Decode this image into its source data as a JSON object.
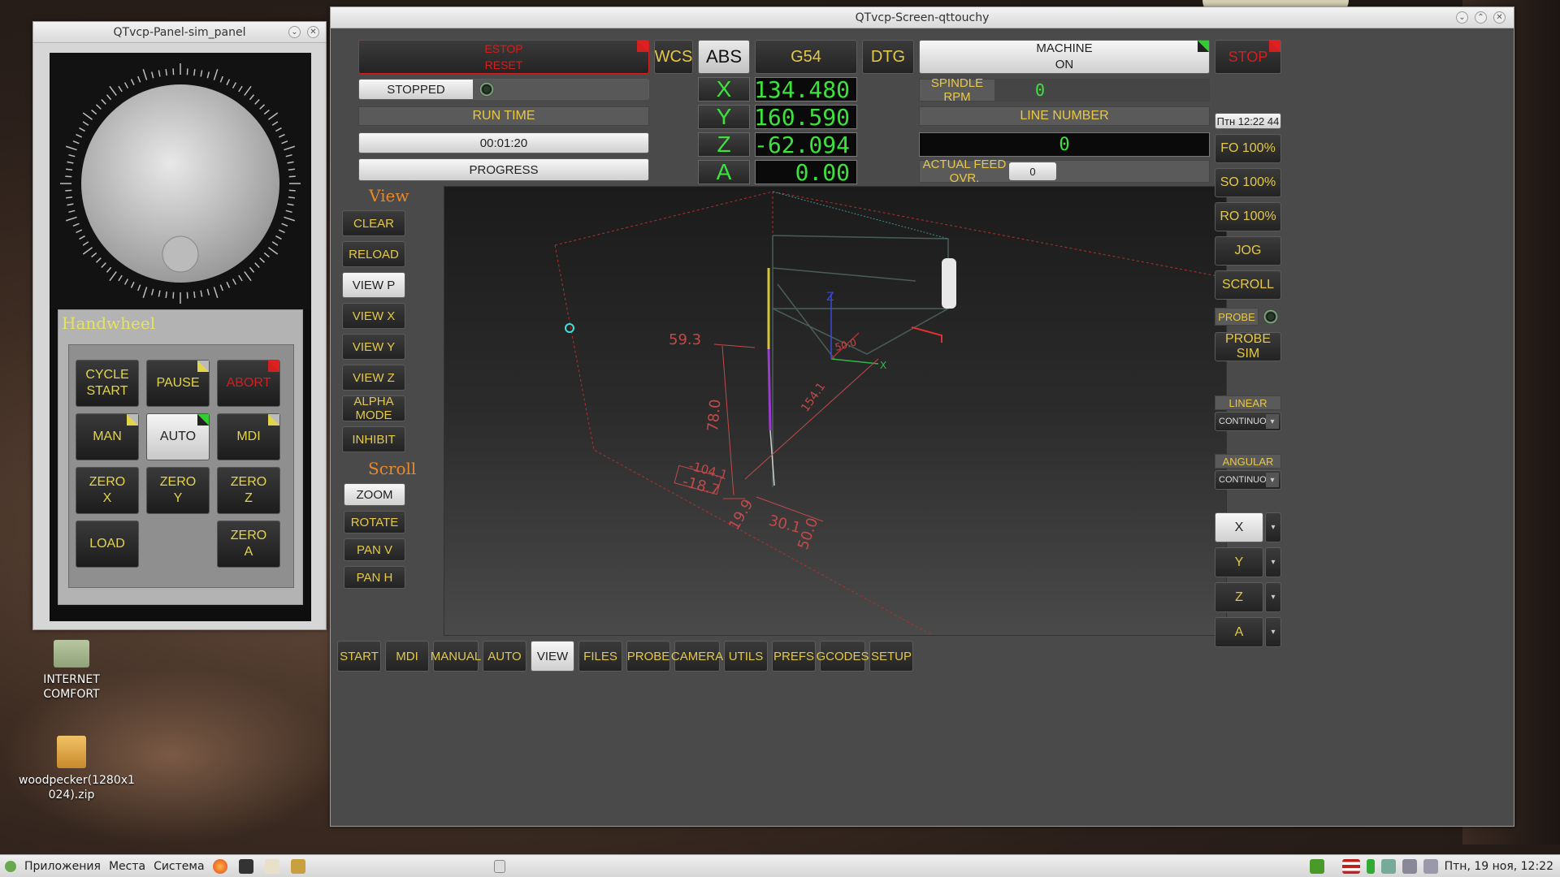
{
  "desktop": {
    "icons": [
      {
        "label": "INTERNET\nCOMFORT"
      },
      {
        "label": "woodpecker(1280x1\n024).zip"
      }
    ]
  },
  "panel_window": {
    "title": "QTvcp-Panel-sim_panel",
    "handwheel_title": "Handwheel",
    "buttons": {
      "cycle_start": "CYCLE\nSTART",
      "pause": "PAUSE",
      "abort": "ABORT",
      "man": "MAN",
      "auto": "AUTO",
      "mdi": "MDI",
      "zero_x": "ZERO\nX",
      "zero_y": "ZERO\nY",
      "zero_z": "ZERO\nZ",
      "load": "LOAD",
      "zero_a": "ZERO\nA"
    }
  },
  "screen_window": {
    "title": "QTvcp-Screen-qttouchy",
    "estop": "ESTOP\nRESET",
    "status": "STOPPED",
    "run_time_label": "RUN TIME",
    "run_time_value": "00:01:20",
    "progress_label": "PROGRESS",
    "wcs": "WCS",
    "abs": "ABS",
    "g54": "G54",
    "dtg": "DTG",
    "machine": "MACHINE\nON",
    "spindle_label": "SPINDLE RPM",
    "spindle_value": "0",
    "line_number_label": "LINE NUMBER",
    "line_number_value": "0",
    "feed_ovr_label": "ACTUAL FEED OVR.",
    "feed_ovr_value": "0",
    "axes": [
      {
        "name": "X",
        "value": "134.480"
      },
      {
        "name": "Y",
        "value": "160.590"
      },
      {
        "name": "Z",
        "value": "-62.094"
      },
      {
        "name": "A",
        "value": "0.00"
      }
    ],
    "view_title": "View",
    "view_buttons": [
      "CLEAR",
      "RELOAD",
      "VIEW P",
      "VIEW X",
      "VIEW Y",
      "VIEW Z",
      "ALPHA MODE",
      "INHIBIT"
    ],
    "scroll_title": "Scroll",
    "scroll_buttons": [
      "ZOOM",
      "ROTATE",
      "PAN V",
      "PAN H"
    ],
    "tabs": [
      "START",
      "MDI",
      "MANUAL",
      "AUTO",
      "VIEW",
      "FILES",
      "PROBE",
      "CAMERA",
      "UTILS",
      "PREFS",
      "GCODES",
      "SETUP"
    ],
    "active_tab": "VIEW",
    "right": {
      "stop": "STOP",
      "clock": "Птн 12:22 44",
      "fo": "FO 100%",
      "so": "SO 100%",
      "ro": "RO 100%",
      "jog": "JOG",
      "scroll": "SCROLL",
      "probe": "PROBE",
      "probe_sim": "PROBE SIM",
      "linear_label": "LINEAR",
      "linear_value": "CONTINUOUS",
      "angular_label": "ANGULAR",
      "angular_value": "CONTINUOUS",
      "jog_axes": [
        "X",
        "Y",
        "Z",
        "A"
      ]
    },
    "dims": [
      "59.3",
      "78.0",
      "-104.1",
      "-18.7",
      "19.9",
      "30.1",
      "50.0",
      "154.1",
      "50.0",
      "Z",
      "X"
    ]
  },
  "taskbar": {
    "apps": "Приложения",
    "places": "Места",
    "system": "Система",
    "clock": "Птн, 19 ноя, 12:22"
  },
  "colors": {
    "accent_yellow": "#e3c84a",
    "lcd_green": "#3de23d",
    "alert_red": "#d02020",
    "section_orange": "#e88a2a"
  }
}
